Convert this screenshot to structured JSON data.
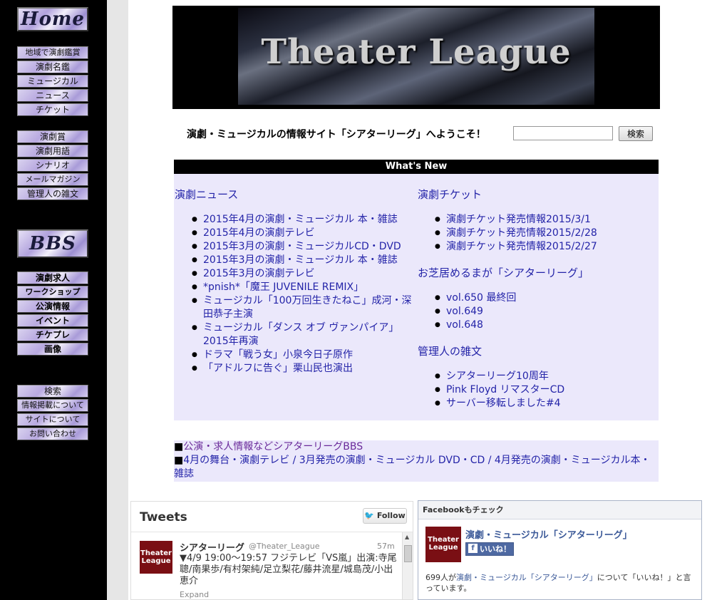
{
  "nav": {
    "home_label": "Home",
    "group1": [
      "地域で演劇鑑賞",
      "演劇名鑑",
      "ミュージカル",
      "ニュース",
      "チケット"
    ],
    "group2": [
      "演劇賞",
      "演劇用語",
      "シナリオ",
      "メールマガジン",
      "管理人の雑文"
    ],
    "bbs_label": "BBS",
    "group3": [
      "演劇求人",
      "ワークショップ",
      "公演情報",
      "イベント",
      "チケプレ",
      "画像"
    ],
    "group4": [
      "検索",
      "情報掲載について",
      "サイトについて",
      "お問い合わせ"
    ]
  },
  "banner": {
    "title": "Theater League"
  },
  "welcome_text": "演劇・ミュージカルの情報サイト「シアターリーグ」へようこそ！",
  "search": {
    "button_label": "検索",
    "value": ""
  },
  "whats_new": {
    "title": "What's New",
    "left": {
      "section_title": "演劇ニュース",
      "items": [
        "2015年4月の演劇・ミュージカル 本・雑誌",
        "2015年4月の演劇テレビ",
        "2015年3月の演劇・ミュージカルCD・DVD",
        "2015年3月の演劇・ミュージカル 本・雑誌",
        "2015年3月の演劇テレビ",
        "*pnish*「魔王 JUVENILE REMIX」",
        "ミュージカル「100万回生きたねこ」成河・深田恭子主演",
        "ミュージカル「ダンス オブ ヴァンパイア」2015年再演",
        "ドラマ「戦う女」小泉今日子原作",
        "「アドルフに告ぐ」栗山民也演出"
      ]
    },
    "right": {
      "ticket_title": "演劇チケット",
      "ticket_items": [
        "演劇チケット発売情報2015/3/1",
        "演劇チケット発売情報2015/2/28",
        "演劇チケット発売情報2015/2/27"
      ],
      "mail_title": "お芝居めるまが「シアターリーグ」",
      "mail_items": [
        "vol.650 最終回",
        "vol.649",
        "vol.648"
      ],
      "essay_title": "管理人の雑文",
      "essay_items": [
        "シアターリーグ10周年",
        "Pink Floyd リマスターCD",
        "サーバー移転しました#4"
      ]
    }
  },
  "bottom_links": {
    "bullet": "■",
    "line1": "公演・求人情報などシアターリーグBBS",
    "line2": "4月の舞台・演劇テレビ / 3月発売の演劇・ミュージカル DVD・CD / 4月発売の演劇・ミュージカル本・雑誌"
  },
  "tweets": {
    "title": "Tweets",
    "follow_label": "Follow",
    "avatar_text": "Theater League",
    "name": "シアターリーグ",
    "handle": "@Theater_League",
    "time": "57m",
    "text": "▼4/9 19:00〜19:57 フジテレビ「VS嵐」出演:寺尾聰/南果歩/有村架純/足立梨花/藤井流星/城島茂/小出恵介",
    "expand": "Expand"
  },
  "facebook": {
    "header": "Facebookもチェック",
    "avatar_text": "Theater League",
    "page_name": "演劇・ミュージカル「シアターリーグ」",
    "like_label": "いいね！",
    "like_icon": "f",
    "desc_pre": "699人が",
    "desc_link": "演劇・ミュージカル「シアターリーグ」",
    "desc_post": "について「いいね！」と言っています。"
  },
  "colors": {
    "link": "#2323a8",
    "panel_bg": "#ebe8fb",
    "sidebar_bg": "#000000"
  }
}
